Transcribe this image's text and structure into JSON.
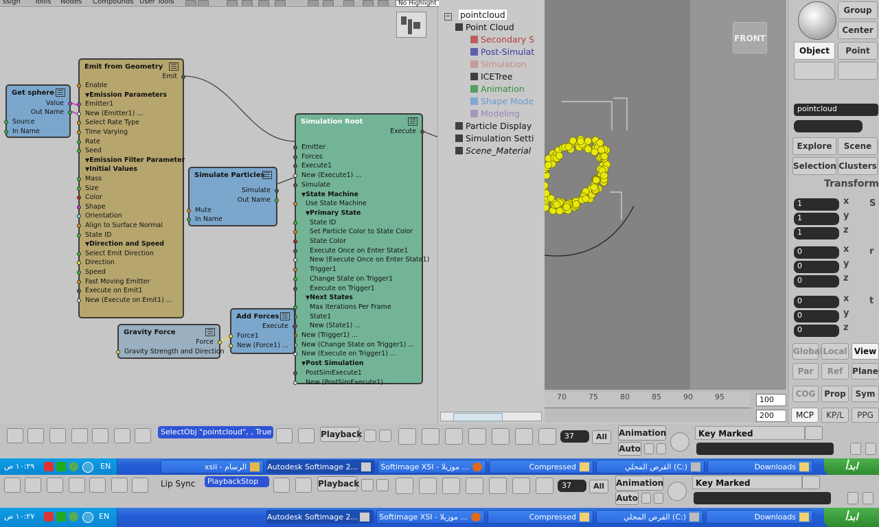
{
  "menubar": {
    "items": [
      "ssign",
      "Tools",
      "Nodes",
      "Compounds",
      "User Tools"
    ],
    "highlight_select": "No Highlight"
  },
  "ice_nodes": {
    "get_sphere": {
      "title": "Get sphere",
      "outputs": [
        "Value",
        "Out Name"
      ],
      "inputs": [
        "Source",
        "In Name"
      ]
    },
    "emit": {
      "title": "Emit from Geometry",
      "output": "Emit",
      "ports": [
        {
          "label": "Enable",
          "kind": "in",
          "color": "#e08a1c"
        },
        {
          "label": "Emission Parameters",
          "kind": "section"
        },
        {
          "label": "Emitter1",
          "kind": "in",
          "color": "#c03cc0"
        },
        {
          "label": "New (Emitter1) ...",
          "kind": "in",
          "color": "#d8d8d8"
        },
        {
          "label": "Select Rate Type",
          "kind": "in",
          "color": "#e08a1c"
        },
        {
          "label": "Time Varying",
          "kind": "in",
          "color": "#e08a1c"
        },
        {
          "label": "Rate",
          "kind": "in",
          "color": "#3cb83c"
        },
        {
          "label": "Seed",
          "kind": "in",
          "color": "#3cb83c"
        },
        {
          "label": "Emission Filter Parameter",
          "kind": "section"
        },
        {
          "label": "Initial Values",
          "kind": "section"
        },
        {
          "label": "Mass",
          "kind": "in",
          "color": "#3cb83c"
        },
        {
          "label": "Size",
          "kind": "in",
          "color": "#3cb83c"
        },
        {
          "label": "Color",
          "kind": "in",
          "color": "#c02020"
        },
        {
          "label": "Shape",
          "kind": "in",
          "color": "#c03cc0"
        },
        {
          "label": "Orientation",
          "kind": "in",
          "color": "#7fd0f0"
        },
        {
          "label": "Align to Surface Normal",
          "kind": "in",
          "color": "#e08a1c"
        },
        {
          "label": "State ID",
          "kind": "in",
          "color": "#3cb83c"
        },
        {
          "label": "Direction and Speed",
          "kind": "section"
        },
        {
          "label": "Select Emit Direction",
          "kind": "in",
          "color": "#3cb83c"
        },
        {
          "label": "Direction",
          "kind": "in",
          "color": "#f0e040"
        },
        {
          "label": "Speed",
          "kind": "in",
          "color": "#3cb83c"
        },
        {
          "label": "Fast Moving Emitter",
          "kind": "in",
          "color": "#e08a1c"
        },
        {
          "label": "Execute on Emit1",
          "kind": "in",
          "color": "#555555"
        },
        {
          "label": "New (Execute on Emit1) ...",
          "kind": "in",
          "color": "#d8d8d8"
        }
      ]
    },
    "sim_particles": {
      "title": "Simulate Particles",
      "outputs": [
        "Simulate",
        "Out Name"
      ],
      "inputs": [
        "Mute",
        "In Name"
      ]
    },
    "sim_root": {
      "title": "Simulation Root",
      "output": "Execute",
      "ports": [
        {
          "label": "Emitter",
          "kind": "in",
          "color": "#555555",
          "indent": 0
        },
        {
          "label": "Forces",
          "kind": "in",
          "color": "#555555",
          "indent": 0
        },
        {
          "label": "Execute1",
          "kind": "in",
          "color": "#555555",
          "indent": 0
        },
        {
          "label": "New (Execute1) ...",
          "kind": "in",
          "color": "#d8d8d8",
          "indent": 0
        },
        {
          "label": "Simulate",
          "kind": "in",
          "color": "#555555",
          "indent": 0
        },
        {
          "label": "State Machine",
          "kind": "section",
          "indent": 0
        },
        {
          "label": "Use State Machine",
          "kind": "in",
          "color": "#e08a1c",
          "indent": 6
        },
        {
          "label": "Primary State",
          "kind": "section",
          "indent": 6
        },
        {
          "label": "State ID",
          "kind": "in",
          "color": "#3cb83c",
          "indent": 12
        },
        {
          "label": "Set Particle Color to State Color",
          "kind": "in",
          "color": "#e08a1c",
          "indent": 12
        },
        {
          "label": "State Color",
          "kind": "in",
          "color": "#c02020",
          "indent": 12
        },
        {
          "label": "Execute Once on Enter State1",
          "kind": "in",
          "color": "#555555",
          "indent": 12
        },
        {
          "label": "New (Execute Once on Enter State1)",
          "kind": "in",
          "color": "#d8d8d8",
          "indent": 12
        },
        {
          "label": "Trigger1",
          "kind": "in",
          "color": "#e08a1c",
          "indent": 12
        },
        {
          "label": "Change State on Trigger1",
          "kind": "in",
          "color": "#3cb83c",
          "indent": 12
        },
        {
          "label": "Execute on Trigger1",
          "kind": "in",
          "color": "#555555",
          "indent": 12
        },
        {
          "label": "Next States",
          "kind": "section",
          "indent": 6
        },
        {
          "label": "Max Iterations Per Frame",
          "kind": "in",
          "color": "#3cb83c",
          "indent": 12
        },
        {
          "label": "State1",
          "kind": "in",
          "color": "#3cb83c",
          "indent": 12
        },
        {
          "label": "New (State1) ...",
          "kind": "in",
          "color": "#d8d8d8",
          "indent": 12
        },
        {
          "label": "New (Trigger1) ...",
          "kind": "in",
          "color": "#e08a1c",
          "indent": 0
        },
        {
          "label": "New (Change State on Trigger1) ...",
          "kind": "in",
          "color": "#d8d8d8",
          "indent": 0
        },
        {
          "label": "New (Execute on Trigger1) ...",
          "kind": "in",
          "color": "#d8d8d8",
          "indent": 0
        },
        {
          "label": "Post Simulation",
          "kind": "section",
          "indent": 0
        },
        {
          "label": "PostSimExecute1",
          "kind": "in",
          "color": "#555555",
          "indent": 6
        },
        {
          "label": "New (PostSimExecute1) ...",
          "kind": "in",
          "color": "#d8d8d8",
          "indent": 6
        }
      ]
    },
    "gravity": {
      "title": "Gravity Force",
      "output": "Force",
      "inputs": [
        "Gravity Strength and Direction"
      ]
    },
    "add_forces": {
      "title": "Add Forces",
      "output": "Execute",
      "inputs": [
        "Force1",
        "New (Force1) ..."
      ]
    }
  },
  "explorer": {
    "root": "pointcloud",
    "items": [
      {
        "label": "Point Cloud",
        "color": "#111111",
        "italic": false
      },
      {
        "label": "Secondary S",
        "color": "#b83a3a",
        "italic": false
      },
      {
        "label": "Post-Simulat",
        "color": "#3a3aa0",
        "italic": false
      },
      {
        "label": "Simulation",
        "color": "#c98a8a",
        "italic": false
      },
      {
        "label": "ICETree",
        "color": "#111111",
        "italic": false
      },
      {
        "label": "Animation",
        "color": "#2f8f3f",
        "italic": false
      },
      {
        "label": "Shape Mode",
        "color": "#6a9ad0",
        "italic": false
      },
      {
        "label": "Modeling",
        "color": "#9a84b8",
        "italic": false
      },
      {
        "label": "Particle Display",
        "color": "#111111",
        "italic": false
      },
      {
        "label": "Simulation Setti",
        "color": "#111111",
        "italic": false
      },
      {
        "label": "Scene_Material",
        "color": "#111111",
        "italic": true
      }
    ]
  },
  "viewport": {
    "view_label": "FRONT"
  },
  "timeline": {
    "ticks": [
      "70",
      "75",
      "80",
      "85",
      "90",
      "95"
    ],
    "frame_start": "100",
    "frame_end": "200"
  },
  "right_panel": {
    "group": "Group",
    "center": "Center",
    "object": "Object",
    "point": "Point",
    "name_field": "pointcloud",
    "explore": "Explore",
    "scene": "Scene",
    "selection": "Selection",
    "clusters": "Clusters",
    "transform": "Transform",
    "scale": [
      "1",
      "1",
      "1"
    ],
    "rotate": [
      "0",
      "0",
      "0"
    ],
    "translate": [
      "0",
      "0",
      "0"
    ],
    "axes": [
      "x",
      "y",
      "z"
    ],
    "side": [
      "S",
      "r",
      "t"
    ],
    "global": "Global",
    "local": "Local",
    "view": "View",
    "par": "Par",
    "ref": "Ref",
    "plane": "Plane",
    "cog": "COG",
    "prop": "Prop",
    "sym": "Sym",
    "mcp": "MCP",
    "kpl": "KP/L",
    "ppg": "PPG"
  },
  "bottom_bar_1": {
    "command": "SelectObj \"pointcloud\", , True",
    "playback": "Playback",
    "frame": "37",
    "all": "All",
    "animation": "Animation",
    "auto": "Auto",
    "key_marked": "Key Marked Parameters"
  },
  "bottom_bar_2": {
    "lip_sync": "Lip Sync",
    "command": "PlaybackStop",
    "playback": "Playback",
    "frame": "37",
    "all": "All",
    "animation": "Animation",
    "auto": "Auto",
    "key_marked": "Key Marked Parameters"
  },
  "taskbar_1": {
    "clock": "١٠:٢٩ ص",
    "lang": "EN",
    "start": "ابدأ",
    "tasks": [
      "xsii - الرسام",
      "Autodesk Softimage 2...",
      "Softimage XSI - موزيلا ...",
      "Compressed",
      "القرص المحلي (C:)",
      "Downloads"
    ]
  },
  "taskbar_2": {
    "clock": "١٠:٢٧ ص",
    "lang": "EN",
    "start": "ابدأ",
    "tasks": [
      "Autodesk Softimage 2...",
      "Softimage XSI - موزيلا ...",
      "Compressed",
      "القرص المحلي (C:)",
      "Downloads"
    ]
  }
}
